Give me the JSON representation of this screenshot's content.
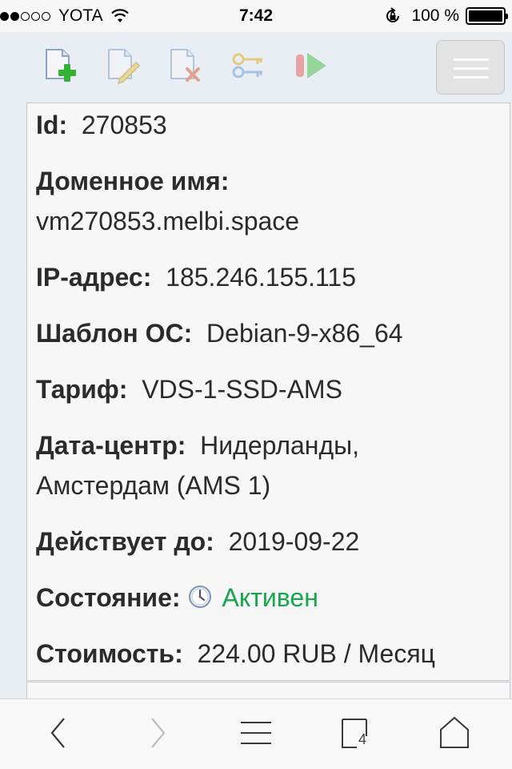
{
  "status_bar": {
    "carrier": "YOTA",
    "time": "7:42",
    "battery": "100 %"
  },
  "toolbar": {
    "icons": [
      "add-document-icon",
      "edit-document-icon",
      "delete-document-icon",
      "keys-icon",
      "start-icon"
    ],
    "menu_icon": "hamburger-icon"
  },
  "details": {
    "id_label": "Id:",
    "id_value": "270853",
    "domain_label": "Доменное имя:",
    "domain_value": "vm270853.melbi.space",
    "ip_label": "IP-адрес:",
    "ip_value": "185.246.155.115",
    "os_label": "Шаблон ОС:",
    "os_value": "Debian-9-x86_64",
    "tariff_label": "Тариф:",
    "tariff_value": "VDS-1-SSD-AMS",
    "dc_label": "Дата-центр:",
    "dc_value_line1": "Нидерланды,",
    "dc_value_line2": "Амстердам (AMS 1)",
    "valid_label": "Действует до:",
    "valid_value": "2019-09-22",
    "state_label": "Состояние:",
    "state_value": "Активен",
    "cost_label": "Стоимость:",
    "cost_value": "224.00 RUB / Месяц"
  },
  "browser_bar": {
    "tab_count": "4"
  },
  "colors": {
    "background": "#e9eef5",
    "active_status": "#17a64b"
  }
}
